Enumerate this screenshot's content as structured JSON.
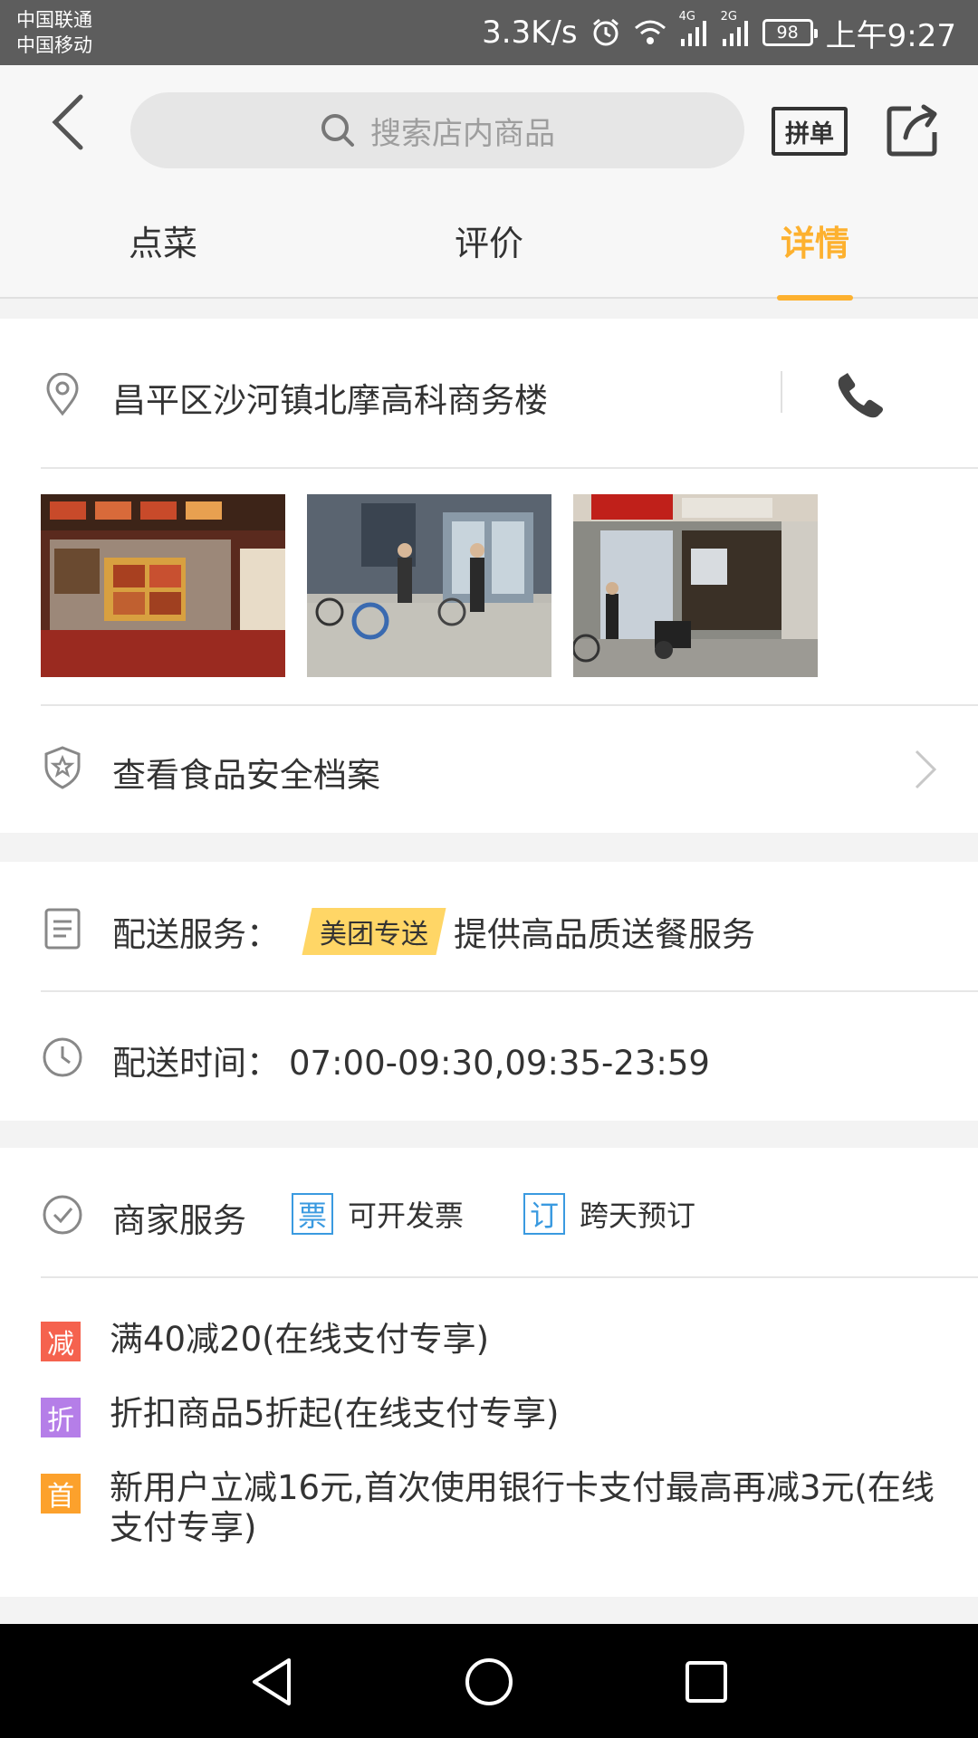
{
  "status_bar": {
    "carrier1": "中国联通",
    "carrier2": "中国移动",
    "network_speed": "3.3K/s",
    "signal1_label": "4G",
    "signal2_label": "2G",
    "battery": "98",
    "time": "上午9:27"
  },
  "header": {
    "search_placeholder": "搜索店内商品",
    "group_order_label": "拼单"
  },
  "tabs": [
    {
      "label": "点菜",
      "active": false
    },
    {
      "label": "评价",
      "active": false
    },
    {
      "label": "详情",
      "active": true
    }
  ],
  "store": {
    "address": "昌平区沙河镇北摩高科商务楼",
    "food_safety_label": "查看食品安全档案"
  },
  "delivery": {
    "service_label": "配送服务：",
    "service_tag": "美团专送",
    "service_desc": "提供高品质送餐服务",
    "time_label": "配送时间：",
    "time_value": "07:00-09:30,09:35-23:59"
  },
  "merchant": {
    "label": "商家服务",
    "services": [
      {
        "badge": "票",
        "text": "可开发票"
      },
      {
        "badge": "订",
        "text": "跨天预订"
      }
    ]
  },
  "promotions": [
    {
      "badge": "减",
      "color": "#f5624e",
      "text": "满40减20(在线支付专享)"
    },
    {
      "badge": "折",
      "color": "#b57ee8",
      "text": "折扣商品5折起(在线支付专享)"
    },
    {
      "badge": "首",
      "color": "#fca12c",
      "text": "新用户立减16元,首次使用银行卡支付最高再减3元(在线支付专享)"
    }
  ],
  "colors": {
    "accent": "#fdb12f",
    "service_blue": "#3a9ae0"
  }
}
